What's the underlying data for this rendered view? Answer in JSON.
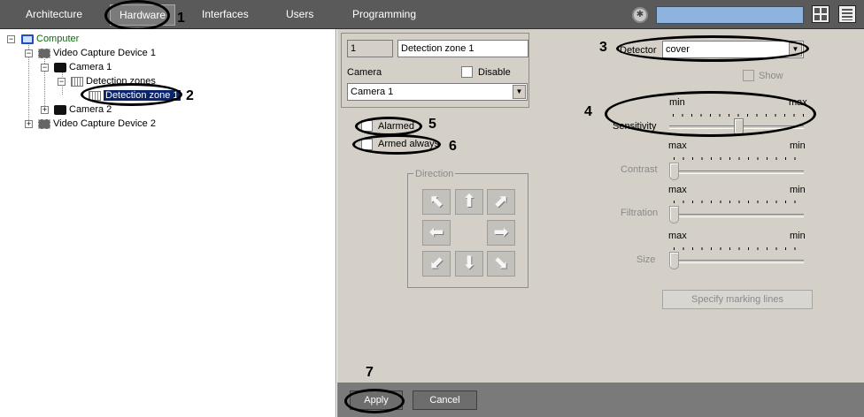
{
  "nav": {
    "tabs": [
      "Architecture",
      "Hardware",
      "Interfaces",
      "Users",
      "Programming"
    ],
    "active_tab": "Hardware"
  },
  "tree": {
    "items": [
      {
        "label": "Computer",
        "icon": "computer-icon"
      },
      {
        "label": "Video Capture Device 1",
        "icon": "chip-icon"
      },
      {
        "label": "Camera 1",
        "icon": "camera-icon"
      },
      {
        "label": "Detection zones",
        "icon": "zones-icon"
      },
      {
        "label": "Detection zone 1",
        "icon": "zones-icon"
      },
      {
        "label": "Camera 2",
        "icon": "camera-icon"
      },
      {
        "label": "Video Capture Device 2",
        "icon": "chip-icon"
      }
    ]
  },
  "panel": {
    "id_value": "1",
    "name_value": "Detection zone 1",
    "camera_label": "Camera",
    "disable_label": "Disable",
    "camera_value": "Camera 1",
    "detector_label": "Detector",
    "detector_value": "cover",
    "show_label": "Show",
    "alarmed_label": "Alarmed",
    "armed_always_label": "Armed always",
    "direction_label": "Direction",
    "sensitivity": {
      "label": "Sensitivity",
      "left": "min",
      "right": "max",
      "value": 0.52
    },
    "contrast": {
      "label": "Contrast",
      "left": "max",
      "right": "min",
      "value": 0.0
    },
    "filtration": {
      "label": "Filtration",
      "left": "max",
      "right": "min",
      "value": 0.0
    },
    "size": {
      "label": "Size",
      "left": "max",
      "right": "min",
      "value": 0.0
    },
    "marking_lines_label": "Specify marking lines",
    "apply_label": "Apply",
    "cancel_label": "Cancel"
  },
  "callouts": [
    "1",
    "2",
    "3",
    "4",
    "5",
    "6",
    "7"
  ],
  "colors": {
    "topbar": "#5a5a5a",
    "panel": "#d4d0c8",
    "selection": "#0a246a"
  }
}
